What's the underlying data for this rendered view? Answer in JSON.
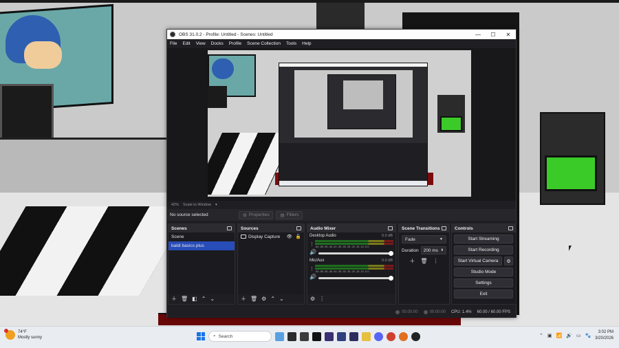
{
  "window": {
    "title": "OBS 31.0.2 - Profile: Untitled - Scenes: Untitled",
    "minimize": "—",
    "maximize": "☐",
    "close": "✕"
  },
  "menu": [
    "File",
    "Edit",
    "View",
    "Docks",
    "Profile",
    "Scene Collection",
    "Tools",
    "Help"
  ],
  "preview": {
    "zoom": "42%",
    "scale_mode": "Scale to Window"
  },
  "context_bar": {
    "no_source": "No source selected",
    "properties": "Properties",
    "filters": "Filters"
  },
  "scenes": {
    "title": "Scenes",
    "items": [
      "Scene",
      "baldi basics plus"
    ],
    "selected_index": 1
  },
  "sources": {
    "title": "Sources",
    "items": [
      {
        "label": "Display Capture"
      }
    ]
  },
  "mixer": {
    "title": "Audio Mixer",
    "ticks": "-60 -55 -50 -45 -40 -35 -30 -25 -20 -15 -10 -5 0",
    "channels": [
      {
        "name": "Desktop Audio",
        "db": "0.0 dB",
        "volume": 1.0
      },
      {
        "name": "Mic/Aux",
        "db": "0.0 dB",
        "volume": 1.0
      }
    ]
  },
  "transitions": {
    "title": "Scene Transitions",
    "selected": "Fade",
    "duration_label": "Duration",
    "duration_value": "200 ms"
  },
  "controls": {
    "title": "Controls",
    "start_streaming": "Start Streaming",
    "start_recording": "Start Recording",
    "start_virtual_camera": "Start Virtual Camera",
    "studio_mode": "Studio Mode",
    "settings": "Settings",
    "exit": "Exit"
  },
  "status": {
    "stream_time": "00:00:00",
    "record_time": "00:00:00",
    "cpu": "CPU: 1.4%",
    "fps": "60.00 / 60.00 FPS"
  },
  "taskbar": {
    "weather_temp": "74°F",
    "weather_desc": "Mostly sunny",
    "search_placeholder": "Search",
    "time": "3:02 PM",
    "date": "3/20/2026"
  },
  "colors": {
    "accent": "#284cb8",
    "obs_bg": "#1f1f23",
    "game_green": "#3bcb29"
  }
}
